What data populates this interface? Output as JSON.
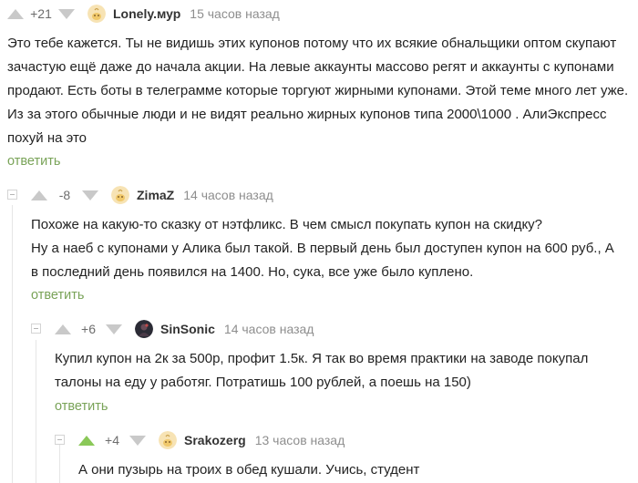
{
  "comments": [
    {
      "rating": "+21",
      "username": "Lonely.мур",
      "time": "15 часов назад",
      "paragraphs": [
        "Это тебе кажется. Ты не видишь этих купонов потому что их всякие обнальщики оптом скупают зачастую ещё даже до начала акции. На левые аккаунты массово регят и аккаунты с купонами продают. Есть боты в телеграмме которые торгуют жирными купонами. Этой теме много лет уже. Из за этого обычные люди и не видят реально жирных купонов типа 2000\\1000 . АлиЭкспресс похуй на это"
      ],
      "reply_label": "ответить"
    },
    {
      "rating": "-8",
      "username": "ZimaZ",
      "time": "14 часов назад",
      "paragraphs": [
        "Похоже на какую-то сказку от нэтфликс. В чем смысл покупать купон на скидку?",
        "Ну а наеб с купонами у Алика был такой. В первый день был доступен купон на 600 руб., А в последний день появился на 1400. Но, сука, все уже было куплено."
      ],
      "reply_label": "ответить"
    },
    {
      "rating": "+6",
      "username": "SinSonic",
      "time": "14 часов назад",
      "paragraphs": [
        "Купил купон на 2к за 500р, профит 1.5к. Я так во время практики на заводе покупал талоны на еду у работяг. Потратишь 100 рублей, а поешь на 150)"
      ],
      "reply_label": "ответить"
    },
    {
      "rating": "+4",
      "username": "Srakozerg",
      "time": "13 часов назад",
      "paragraphs": [
        "А они пузырь на троих в обед кушали. Учись, студент"
      ]
    }
  ],
  "colors": {
    "upvote_active": "#8ac858",
    "reply_link": "#79a358"
  },
  "icons": {
    "vote_up": "triangle-up-icon",
    "vote_down": "triangle-down-icon",
    "collapse": "minus-box-icon",
    "avatar_default": "pikabu-peach-avatar",
    "avatar_sinsonic": "dark-figure-avatar"
  }
}
